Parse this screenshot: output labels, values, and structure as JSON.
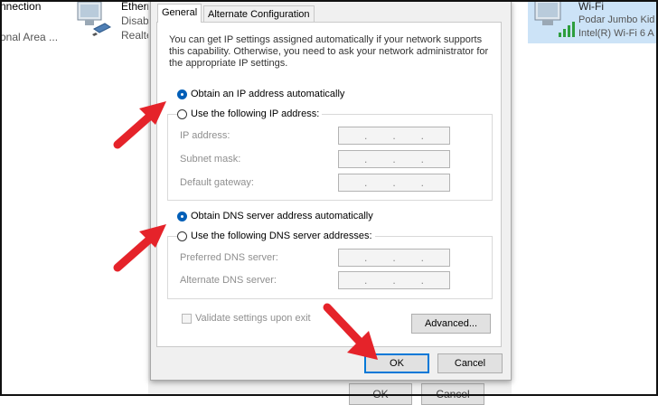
{
  "background": {
    "connection1": {
      "name": "nnection",
      "status": "onal Area ..."
    },
    "ethernet": {
      "name": "Etherr",
      "status": "Disab",
      "device": "Realte",
      "icon": "ethernet-adapter-icon"
    },
    "wifi": {
      "name": "Wi-Fi",
      "network": "Podar Jumbo Kid",
      "device": "Intel(R) Wi-Fi 6 A",
      "icon": "wifi-adapter-icon"
    },
    "under_buttons": {
      "ok": "OK",
      "cancel": "Cancel"
    }
  },
  "dialog": {
    "tabs": [
      {
        "label": "General",
        "active": true
      },
      {
        "label": "Alternate Configuration",
        "active": false
      }
    ],
    "description": "You can get IP settings assigned automatically if your network supports this capability. Otherwise, you need to ask your network administrator for the appropriate IP settings.",
    "ip": {
      "auto_label": "Obtain an IP address automatically",
      "auto_selected": true,
      "manual_label": "Use the following IP address:",
      "manual_selected": false,
      "fields": [
        {
          "label": "IP address:",
          "value": ". . ."
        },
        {
          "label": "Subnet mask:",
          "value": ". . ."
        },
        {
          "label": "Default gateway:",
          "value": ". . ."
        }
      ]
    },
    "dns": {
      "auto_label": "Obtain DNS server address automatically",
      "auto_selected": true,
      "manual_label": "Use the following DNS server addresses:",
      "manual_selected": false,
      "fields": [
        {
          "label": "Preferred DNS server:",
          "value": ". . ."
        },
        {
          "label": "Alternate DNS server:",
          "value": ". . ."
        }
      ]
    },
    "validate_label": "Validate settings upon exit",
    "validate_checked": false,
    "advanced_label": "Advanced...",
    "ok_label": "OK",
    "cancel_label": "Cancel"
  },
  "colors": {
    "accent": "#0078d7",
    "radio_selected": "#005fb8",
    "annotation_arrow": "#e5232a"
  }
}
